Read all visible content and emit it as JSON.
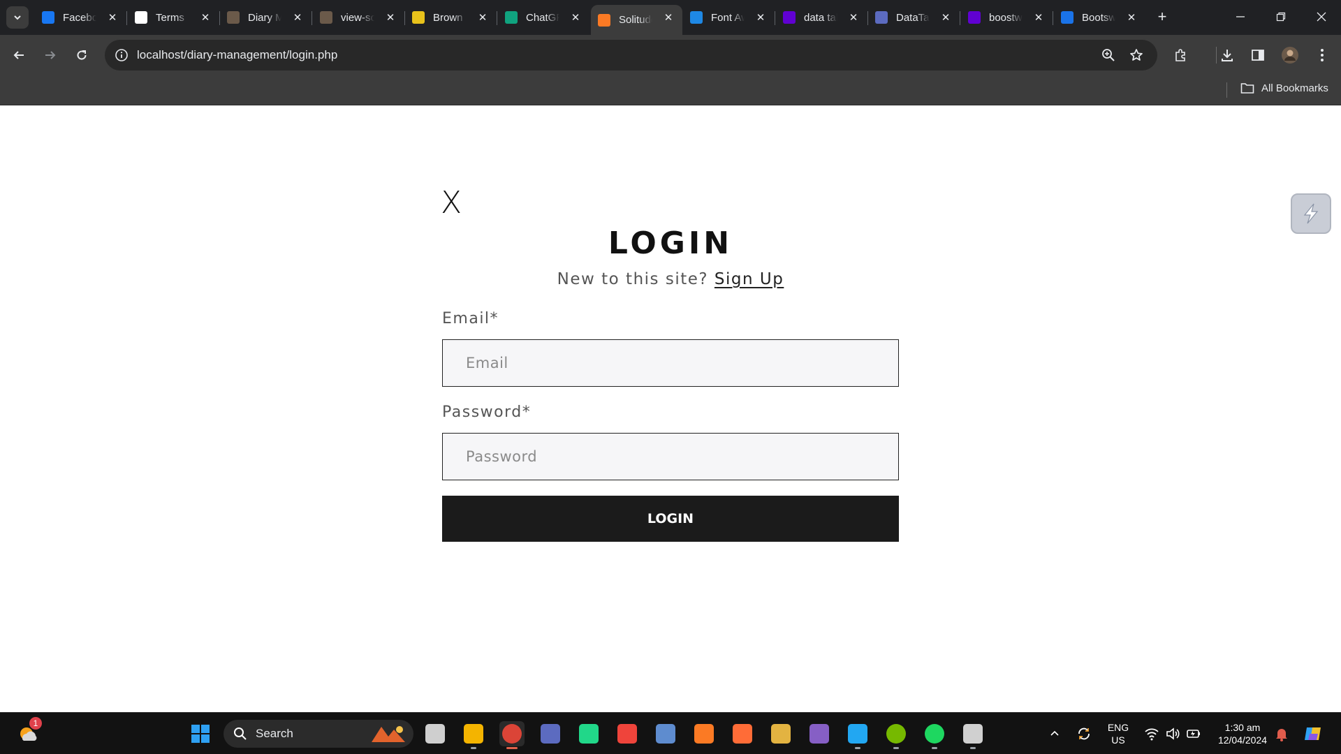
{
  "browser": {
    "tabs": [
      {
        "label": "Facebook",
        "icon": "facebook-icon",
        "color": "#1877f2"
      },
      {
        "label": "Terms",
        "icon": "wix-icon",
        "color": "#ffffff"
      },
      {
        "label": "Diary Management",
        "icon": "avatar-favicon",
        "color": "#6b5a4a"
      },
      {
        "label": "view-source",
        "icon": "avatar-favicon",
        "color": "#6b5a4a"
      },
      {
        "label": "Brown",
        "icon": "flag-favicon",
        "color": "#e8c21b"
      },
      {
        "label": "ChatGPT",
        "icon": "chatgpt-icon",
        "color": "#10a37f"
      },
      {
        "label": "Solitude",
        "icon": "xampp-icon",
        "color": "#fb7a24",
        "active": true
      },
      {
        "label": "Font Awesome",
        "icon": "flag-icon",
        "color": "#1e88e5"
      },
      {
        "label": "data table",
        "icon": "yahoo-icon",
        "color": "#6001d2"
      },
      {
        "label": "DataTables",
        "icon": "datatables-icon",
        "color": "#5c6bc0"
      },
      {
        "label": "boostwrap",
        "icon": "yahoo-icon",
        "color": "#6001d2"
      },
      {
        "label": "Bootswatch",
        "icon": "bootswatch-icon",
        "color": "#1a73e8"
      }
    ],
    "url": "localhost/diary-management/login.php",
    "bookmarks_label": "All Bookmarks"
  },
  "page": {
    "close_label": "X",
    "title": "LOGIN",
    "signup_prompt": "New to this site?",
    "signup_link": "Sign Up",
    "email_label": "Email*",
    "email_placeholder": "Email",
    "email_value": "",
    "password_label": "Password*",
    "password_placeholder": "Password",
    "password_value": "",
    "login_button": "LOGIN"
  },
  "taskbar": {
    "search_label": "Search",
    "weather_badge": "1",
    "language": "ENG",
    "region": "US",
    "time": "1:30 am",
    "date": "12/04/2024",
    "apps": [
      {
        "name": "task-view-icon",
        "color": "#cfcfcf"
      },
      {
        "name": "file-explorer-icon",
        "color": "#f4b400"
      },
      {
        "name": "chrome-icon",
        "color": "#db4437"
      },
      {
        "name": "git-icon",
        "color": "#5c6bc0"
      },
      {
        "name": "pycharm-icon",
        "color": "#21d789"
      },
      {
        "name": "anydesk-icon",
        "color": "#ef443b"
      },
      {
        "name": "virtualbox-icon",
        "color": "#5e8ccf"
      },
      {
        "name": "xampp-icon",
        "color": "#fb7a24"
      },
      {
        "name": "postman-icon",
        "color": "#ff6c37"
      },
      {
        "name": "photo-app-icon",
        "color": "#e3b341"
      },
      {
        "name": "visual-studio-icon",
        "color": "#865fc5"
      },
      {
        "name": "vscode-icon",
        "color": "#22a7f2"
      },
      {
        "name": "utorrent-icon",
        "color": "#76b900"
      },
      {
        "name": "spotify-icon",
        "color": "#1ed760"
      },
      {
        "name": "terminal-icon",
        "color": "#d0d0d0"
      }
    ]
  }
}
